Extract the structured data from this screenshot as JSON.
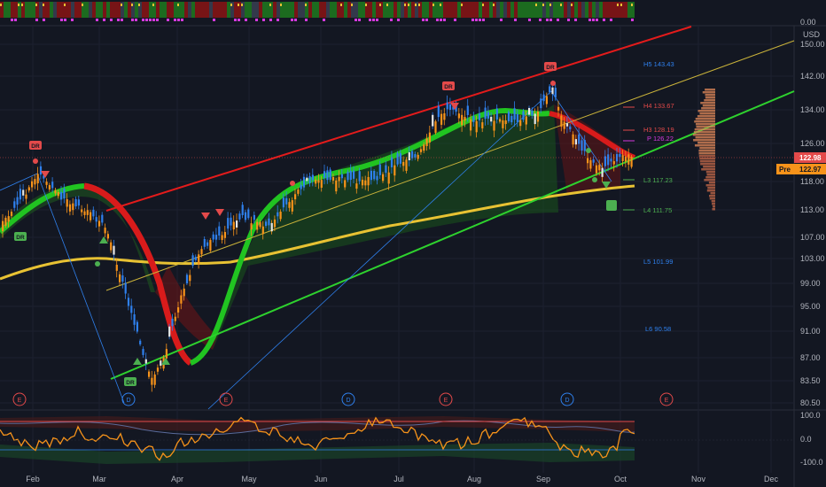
{
  "currency": "USD",
  "top_panel": {
    "value_label": "0.00"
  },
  "price_axis": [
    "150.00",
    "142.00",
    "134.00",
    "126.00",
    "118.00",
    "113.00",
    "107.00",
    "103.00",
    "99.00",
    "95.00",
    "91.00",
    "87.00",
    "83.50",
    "80.50"
  ],
  "osc_axis": [
    "100.0",
    "0.0",
    "-100.0"
  ],
  "time_axis": [
    "Feb",
    "Mar",
    "Apr",
    "May",
    "Jun",
    "Jul",
    "Aug",
    "Sep",
    "Oct",
    "Nov",
    "Dec"
  ],
  "last_price": {
    "value": "122.98",
    "color": "#e34a4a"
  },
  "pre_market": {
    "label": "Pre",
    "value": "122.97",
    "color": "#f7931a"
  },
  "pivots": [
    {
      "label": "H5 143.43",
      "color": "#2f80ed"
    },
    {
      "label": "H4 133.67",
      "color": "#e34a4a"
    },
    {
      "label": "H3 128.19",
      "color": "#e34a4a"
    },
    {
      "label": "P 126.22",
      "color": "#d63adf"
    },
    {
      "label": "L3 117.23",
      "color": "#4caf50"
    },
    {
      "label": "L4 111.75",
      "color": "#4caf50"
    },
    {
      "label": "L5 101.99",
      "color": "#2f80ed"
    },
    {
      "label": "L6 90.58",
      "color": "#2f80ed"
    }
  ],
  "events": [
    {
      "label": "E",
      "type": "earnings"
    },
    {
      "label": "D",
      "type": "dividend"
    },
    {
      "label": "E",
      "type": "earnings"
    },
    {
      "label": "D",
      "type": "dividend"
    },
    {
      "label": "E",
      "type": "earnings"
    },
    {
      "label": "D",
      "type": "dividend"
    },
    {
      "label": "E",
      "type": "earnings"
    }
  ],
  "signal_tags": [
    "DR",
    "DR",
    "DR",
    "DR",
    "DR"
  ],
  "colors": {
    "background": "#131722",
    "bull_candle": "#2f80ed",
    "bear_candle": "#f7931a",
    "channel_top": "#e31b1b",
    "channel_bottom": "#2ed12e",
    "ma_long": "#e8c233",
    "cloud_bull": "#1f7a1f",
    "cloud_bear": "#8a1414"
  }
}
